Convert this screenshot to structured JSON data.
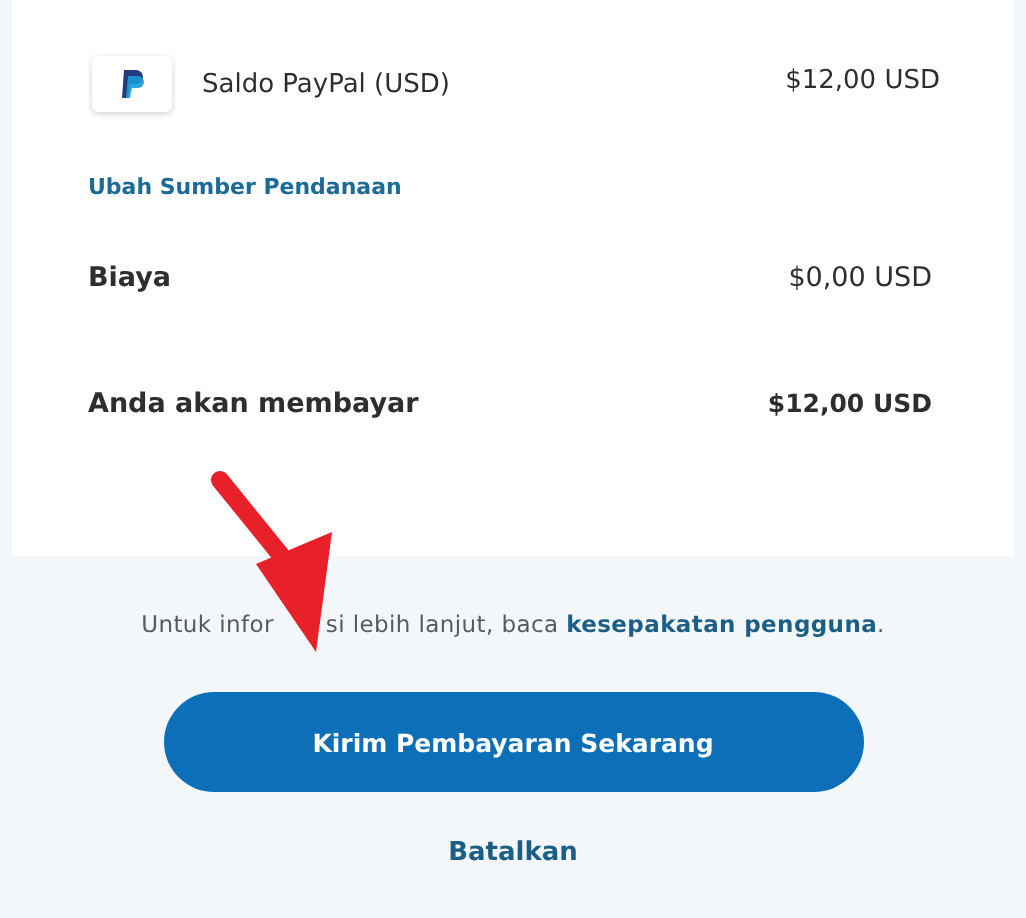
{
  "funding_source": {
    "name": "Saldo PayPal (USD)",
    "amount": "$12,00 USD"
  },
  "change_link": "Ubah Sumber Pendanaan",
  "summary": [
    {
      "label": "Biaya",
      "value": "$0,00 USD",
      "emphasis": false
    },
    {
      "label": "Anda akan membayar",
      "value": "$12,00 USD",
      "emphasis": true
    }
  ],
  "info": {
    "before_arrow": "Untuk infor",
    "after_arrow": "si lebih lanjut, baca",
    "link": "kesepakatan pengguna",
    "end": "."
  },
  "primary_button": "Kirim Pembayaran Sekarang",
  "cancel_link": "Batalkan"
}
